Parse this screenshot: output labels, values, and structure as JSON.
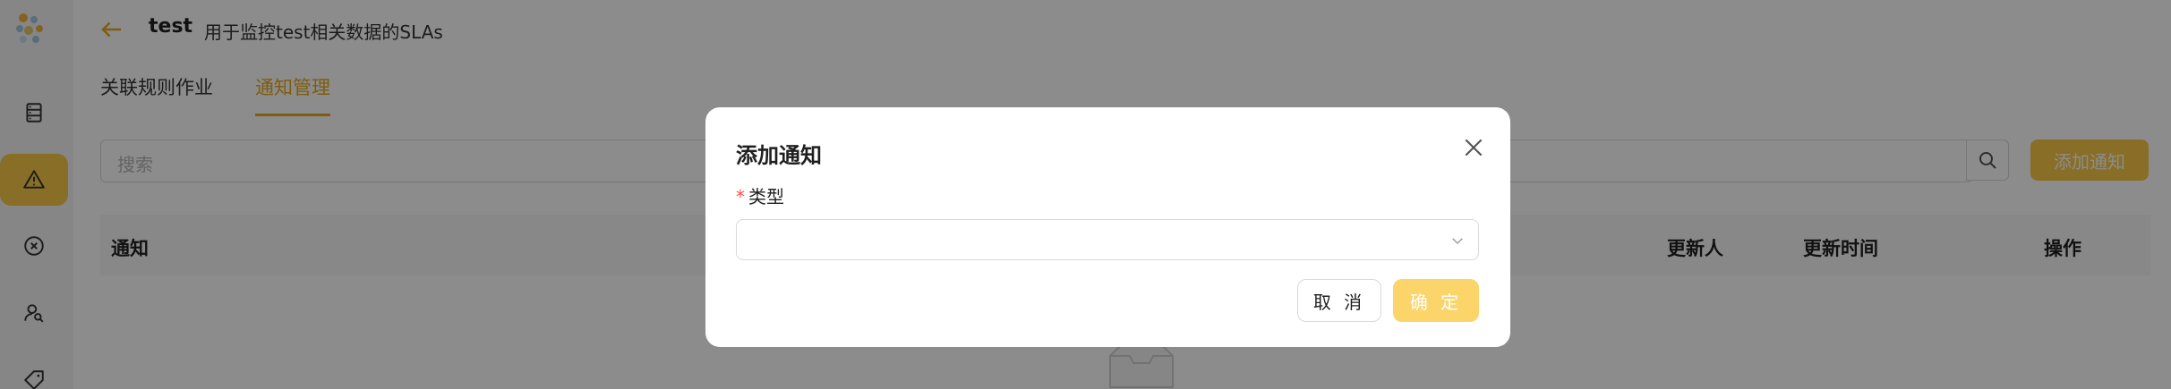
{
  "header": {
    "title": "test",
    "subtitle": "用于监控test相关数据的SLAs"
  },
  "sidebar": {
    "items": [
      {
        "icon": "database-icon",
        "active": false
      },
      {
        "icon": "alert-triangle-icon",
        "active": true
      },
      {
        "icon": "close-circle-icon",
        "active": false
      },
      {
        "icon": "user-search-icon",
        "active": false
      },
      {
        "icon": "tag-icon",
        "active": false
      }
    ]
  },
  "tabs": [
    {
      "label": "关联规则作业",
      "active": false
    },
    {
      "label": "通知管理",
      "active": true
    }
  ],
  "search": {
    "placeholder": "搜索"
  },
  "toolbar": {
    "add_label": "添加通知"
  },
  "table": {
    "columns": [
      "通知",
      "更新人",
      "更新时间",
      "操作"
    ]
  },
  "modal": {
    "title": "添加通知",
    "field_label": "类型",
    "field_value": "",
    "cancel_label": "取 消",
    "ok_label": "确 定"
  },
  "colors": {
    "accent": "#f8c948",
    "tab_active": "#e9a81a",
    "required": "#ff4d4f",
    "overlay": "rgba(0,0,0,0.45)"
  }
}
